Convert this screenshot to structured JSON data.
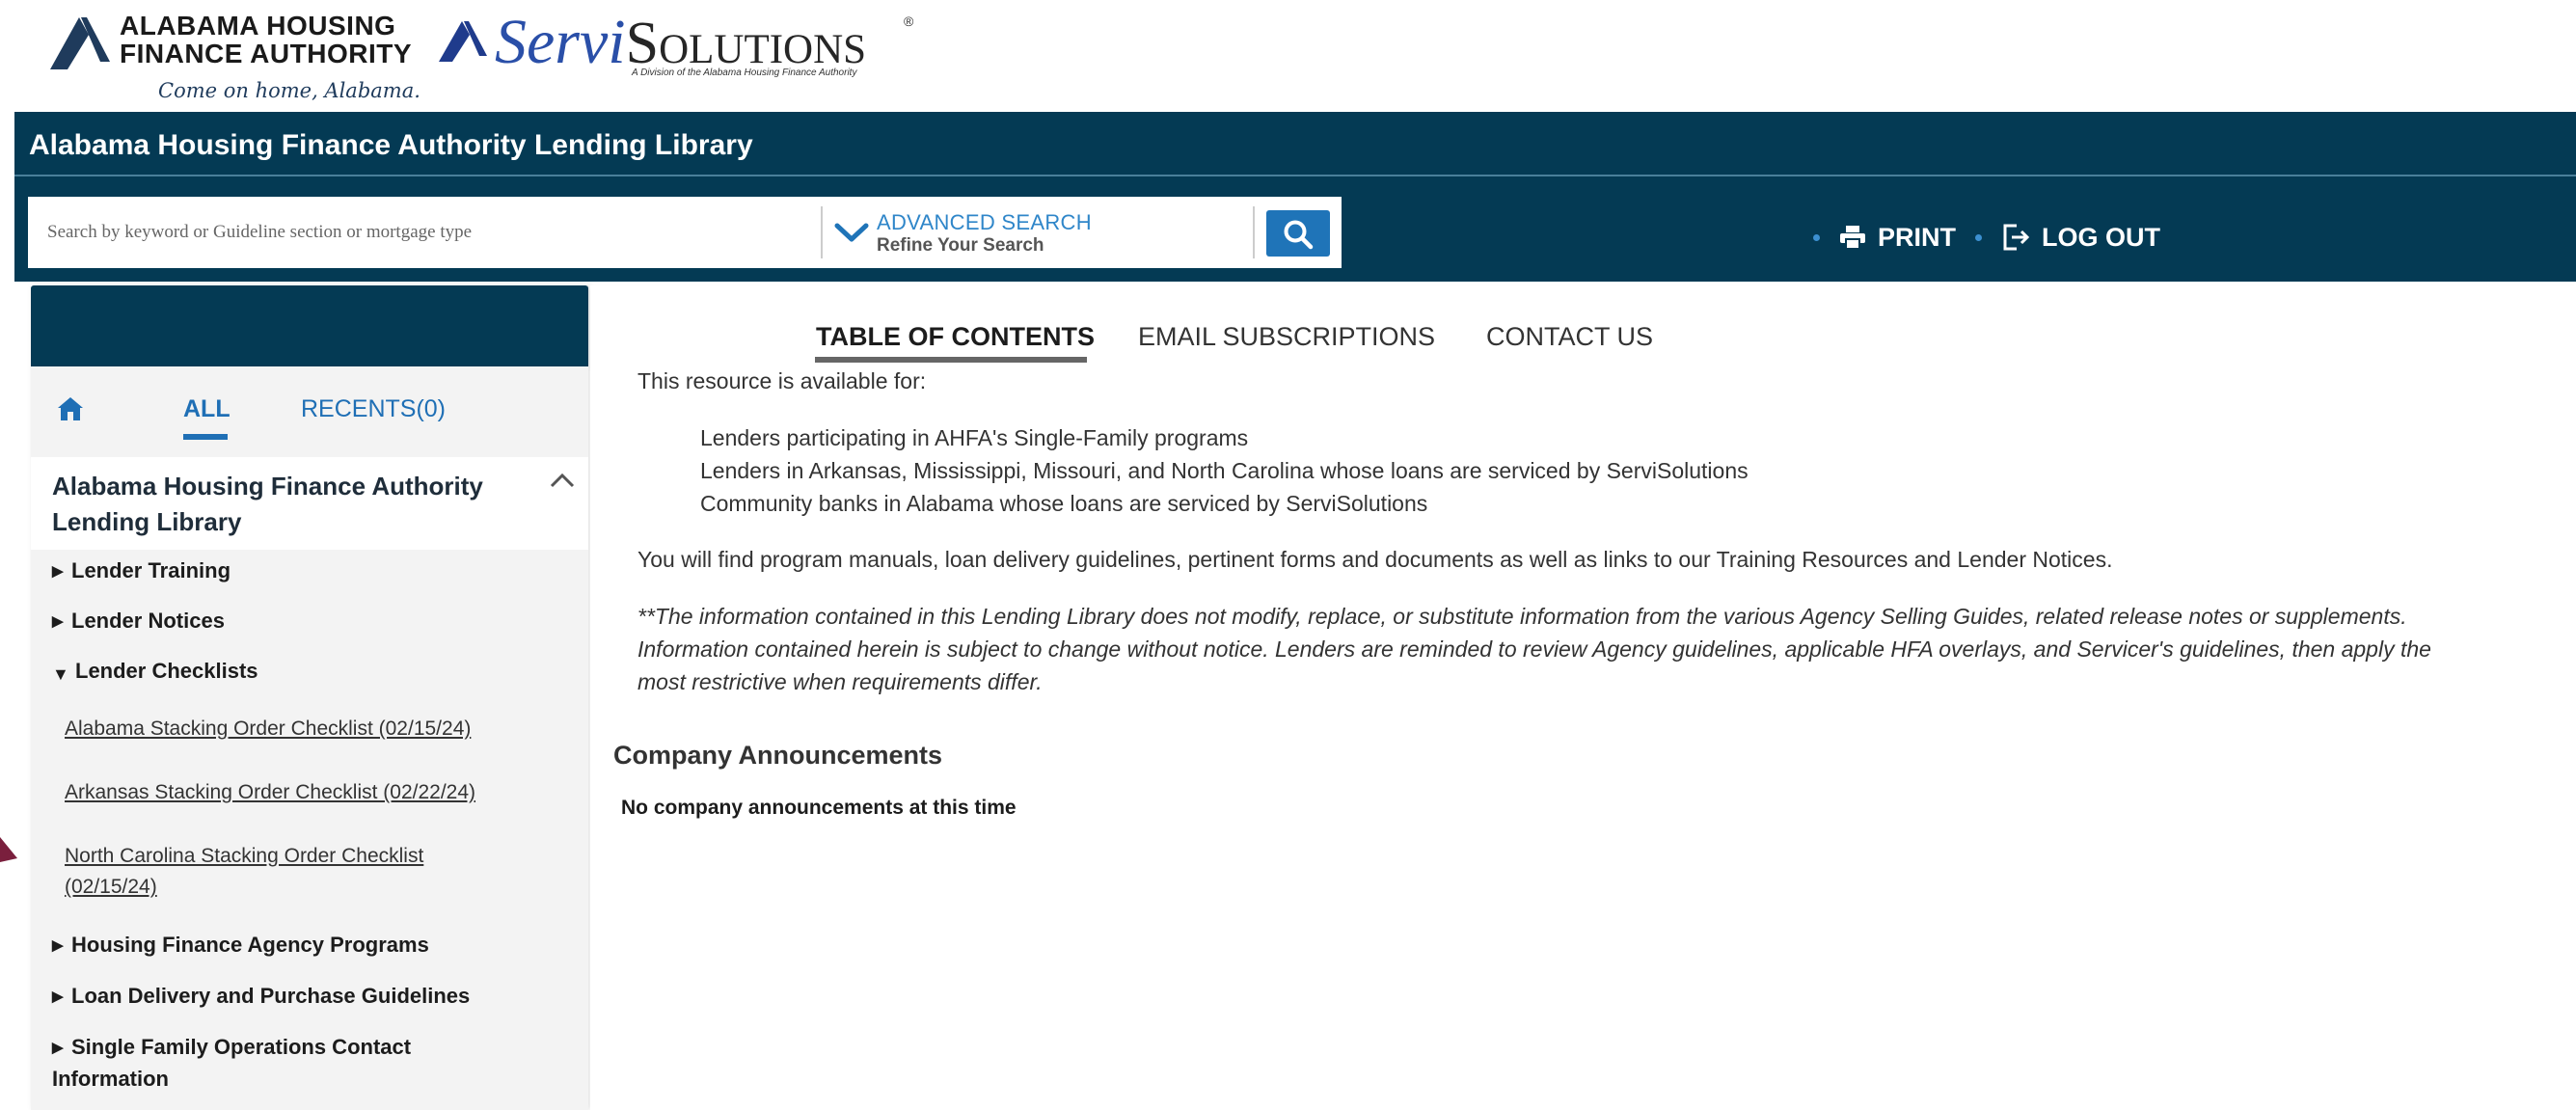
{
  "logos": {
    "ahfa_line1": "ALABAMA HOUSING",
    "ahfa_line2": "FINANCE AUTHORITY",
    "ahfa_tagline": "Come on home, Alabama.",
    "servi_part1": "Servi",
    "servi_part2": "Solutions",
    "servi_reg": "®",
    "servi_sub": "A Division of the Alabama Housing Finance Authority"
  },
  "header": {
    "title": "Alabama Housing Finance Authority Lending Library",
    "search_placeholder": "Search by keyword or Guideline section or mortgage type",
    "advanced_title": "ADVANCED SEARCH",
    "advanced_sub": "Refine Your Search",
    "print_label": "PRINT",
    "logout_label": "LOG OUT"
  },
  "sidebar": {
    "tab_all": "ALL",
    "tab_recents": "RECENTS(0)",
    "library_title": "Alabama Housing Finance Authority Lending Library",
    "items": [
      {
        "label": "Lender Training"
      },
      {
        "label": "Lender Notices"
      },
      {
        "label": "Lender Checklists"
      },
      {
        "label": "Alabama Stacking Order Checklist (02/15/24)"
      },
      {
        "label": "Arkansas Stacking Order Checklist (02/22/24)"
      },
      {
        "label": "North Carolina Stacking Order Checklist (02/15/24)"
      },
      {
        "label": "Housing Finance Agency Programs"
      },
      {
        "label": "Loan Delivery and Purchase Guidelines"
      },
      {
        "label": "Single Family Operations Contact Information"
      }
    ]
  },
  "main": {
    "tabs": [
      {
        "label": "TABLE OF CONTENTS"
      },
      {
        "label": "EMAIL SUBSCRIPTIONS"
      },
      {
        "label": "CONTACT US"
      }
    ],
    "intro": "This resource is available for:",
    "audiences": [
      "Lenders participating in AHFA's Single-Family programs",
      "Lenders in Arkansas, Mississippi, Missouri, and North Carolina whose loans are serviced by ServiSolutions",
      "Community banks in Alabama whose loans are serviced by ServiSolutions"
    ],
    "summary": "You will find program manuals, loan delivery guidelines, pertinent forms and documents as well as links to our Training Resources and Lender Notices.",
    "disclaimer": [
      "**The information contained in this Lending Library does not modify, replace, or substitute information from the various Agency Selling Guides, related release notes or supplements.",
      "Information contained herein is subject to change without notice. Lenders are reminded to review Agency guidelines, applicable HFA overlays, and Servicer's guidelines, then apply the",
      "most restrictive when requirements differ."
    ],
    "announcements_heading": "Company Announcements",
    "announcements_empty": "No company announcements at this time"
  },
  "colors": {
    "header_bg": "#043a54",
    "accent_blue": "#1f74b8",
    "link_blue": "#2f86c9",
    "sidebar_bg": "#f3f3f3"
  },
  "icons": [
    "home-icon",
    "chevron-up-icon",
    "chevron-down-icon",
    "search-icon",
    "print-icon",
    "logout-icon"
  ]
}
